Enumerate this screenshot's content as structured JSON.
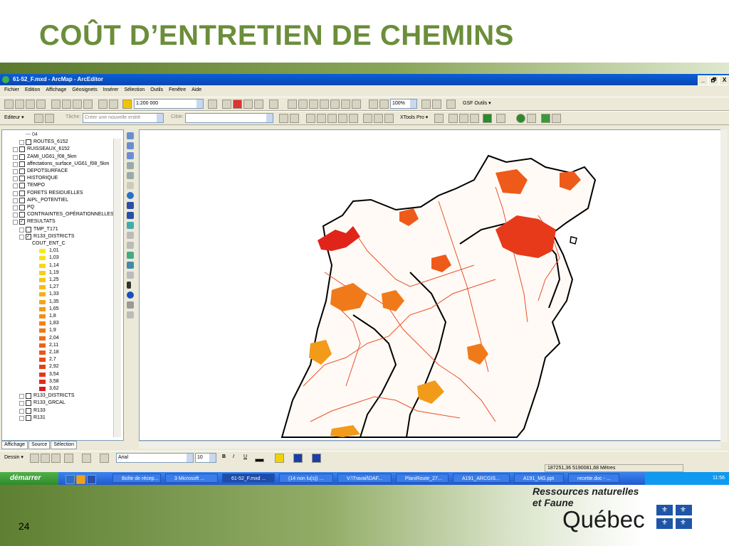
{
  "slide": {
    "title": "COÛT D’ENTRETIEN DE CHEMINS",
    "page_number": "24",
    "org_line1": "Ressources naturelles",
    "org_line2": "et Faune",
    "org_name": "Québec",
    "title_color": "#6b8e3a"
  },
  "window": {
    "title": "61-52_F.mxd - ArcMap - ArcEditor",
    "controls": [
      "_",
      "🗗",
      "X"
    ]
  },
  "menu": [
    "Fichier",
    "Edition",
    "Affichage",
    "Géosignets",
    "Insérer",
    "Sélection",
    "Outils",
    "Fenêtre",
    "Aide"
  ],
  "toolbar1": {
    "scale": "1:200 000",
    "zoom": "100%",
    "gsf_label": "GSF Outils ▾"
  },
  "toolbar2": {
    "editor_label": "Editeur ▾",
    "task_label": "Tâche:",
    "task_value": "Créer une nouvelle entité",
    "target_label": "Cible:",
    "xtools_label": "XTools Pro ▾"
  },
  "toc": {
    "rows": [
      {
        "text": "--- 04",
        "indent": 3,
        "type": "legend"
      },
      {
        "text": "ROUTES_6152",
        "indent": 2,
        "type": "layer",
        "checked": false
      },
      {
        "text": "RUISSEAUX_6152",
        "indent": 1,
        "type": "layer",
        "checked": false
      },
      {
        "text": "ZAMI_UG61_f08_5km",
        "indent": 1,
        "type": "layer",
        "checked": false
      },
      {
        "text": "affectations_surface_UG61_f08_5km",
        "indent": 1,
        "type": "layer",
        "checked": false
      },
      {
        "text": "DEPOTSURFACE",
        "indent": 1,
        "type": "layer",
        "checked": false
      },
      {
        "text": "HISTORIQUE",
        "indent": 1,
        "type": "layer",
        "checked": false
      },
      {
        "text": "TEMPO",
        "indent": 1,
        "type": "layer",
        "checked": false
      },
      {
        "text": "FORETS RESIDUELLES",
        "indent": 1,
        "type": "layer",
        "checked": false
      },
      {
        "text": "AIPL_POTENTIEL",
        "indent": 1,
        "type": "layer",
        "checked": false
      },
      {
        "text": "PQ",
        "indent": 1,
        "type": "layer",
        "checked": false
      },
      {
        "text": "CONTRAINTES_OPÉRATIONNELLES",
        "indent": 1,
        "type": "layer",
        "checked": false
      },
      {
        "text": "RESULTATS",
        "indent": 1,
        "type": "group",
        "checked": true
      },
      {
        "text": "TMP_T171",
        "indent": 2,
        "type": "layer",
        "checked": false
      },
      {
        "text": "R133_DISTRICTS",
        "indent": 2,
        "type": "layer",
        "checked": true
      },
      {
        "text": "COUT_ENT_C",
        "indent": 4,
        "type": "field"
      }
    ],
    "legend_classes": [
      {
        "label": "1,01",
        "color": "#f7ec1a"
      },
      {
        "label": "1,03",
        "color": "#f7e21a"
      },
      {
        "label": "1,14",
        "color": "#f7d81a"
      },
      {
        "label": "1,19",
        "color": "#f7ce1a"
      },
      {
        "label": "1,25",
        "color": "#f7c41a"
      },
      {
        "label": "1,27",
        "color": "#f7ba1a"
      },
      {
        "label": "1,33",
        "color": "#f7b01a"
      },
      {
        "label": "1,35",
        "color": "#f5a51a"
      },
      {
        "label": "1,65",
        "color": "#f59a1a"
      },
      {
        "label": "1,8",
        "color": "#f38f1a"
      },
      {
        "label": "1,83",
        "color": "#f1841a"
      },
      {
        "label": "1,9",
        "color": "#ef791a"
      },
      {
        "label": "2,04",
        "color": "#ed6e1a"
      },
      {
        "label": "2,11",
        "color": "#eb631a"
      },
      {
        "label": "2,18",
        "color": "#e9581a"
      },
      {
        "label": "2,7",
        "color": "#e74d1a"
      },
      {
        "label": "2,92",
        "color": "#e5421a"
      },
      {
        "label": "3,54",
        "color": "#e3371a"
      },
      {
        "label": "3,58",
        "color": "#e12c1a"
      },
      {
        "label": "3,62",
        "color": "#df1a1a"
      }
    ],
    "bottom_rows": [
      {
        "text": "R133_DISTRICTS",
        "checked": false
      },
      {
        "text": "R133_GRCAL",
        "checked": false
      },
      {
        "text": "R133",
        "checked": false
      },
      {
        "text": "R131",
        "checked": false
      }
    ],
    "tabs": [
      "Affichage",
      "Source",
      "Sélection"
    ]
  },
  "drawbar": {
    "dessin_label": "Dessin ▾",
    "font": "Arial",
    "size": "10",
    "bold": "B",
    "italic": "I",
    "underline": "U"
  },
  "status": {
    "coordinates": "187251,36  5190081,68 Mètres"
  },
  "taskbar": {
    "start_label": "démarrer",
    "tasks": [
      "Boîte de récep...",
      "3 Microsoft ...",
      "61-52_F.mxd ...",
      "(14 non lu(s)) ...",
      "V:\\Travail\\DAF...",
      "PlaniRoute_27...",
      "A191_ARCGIS...",
      "A191_MG.ppt",
      "recette.doc - ..."
    ],
    "clock": "11:56"
  }
}
